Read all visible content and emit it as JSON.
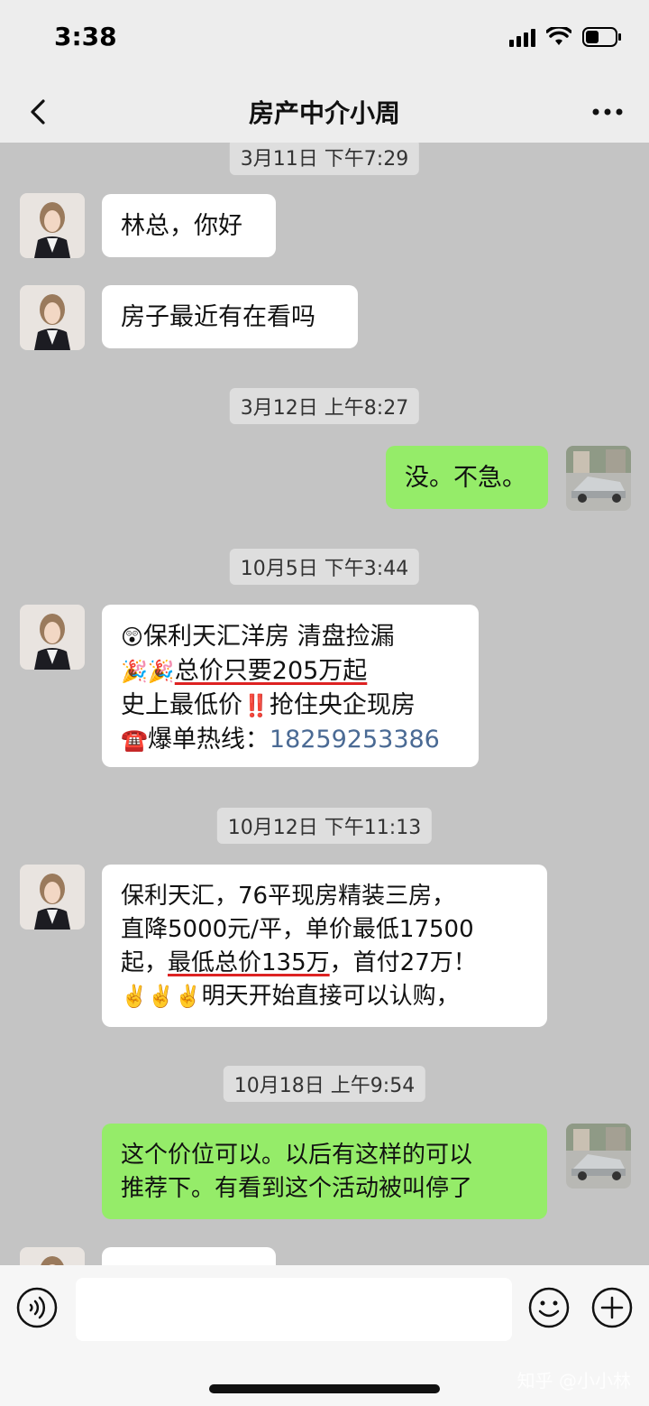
{
  "status": {
    "time": "3:38"
  },
  "header": {
    "title": "房产中介小周"
  },
  "messages": {
    "ts1": "3月11日 下午7:29",
    "m1": "林总，你好",
    "m2": "房子最近有在看吗",
    "ts2": "3月12日 上午8:27",
    "m3": "没。不急。",
    "ts3": "10月5日 下午3:44",
    "m4": {
      "l1_emoji": "😲",
      "l1": "保利天汇洋房 清盘捡漏",
      "l2_emoji": "🎉🎉",
      "l2": "总价只要205万起",
      "l3a": "史上最低价",
      "l3_emoji": "‼️",
      "l3b": "抢住央企现房",
      "l4_emoji": "☎️",
      "l4a": "爆单热线：",
      "l4b": "18259253386"
    },
    "ts4": "10月12日 下午11:13",
    "m5": {
      "l1": "保利天汇，76平现房精装三房，",
      "l2": "直降5000元/平，单价最低17500",
      "l3a": "起，",
      "l3b": "最低总价135万",
      "l3c": "，首付27万！",
      "l4_emoji": "✌️✌️✌️",
      "l4": "明天开始直接可以认购，"
    },
    "ts5": "10月18日 上午9:54",
    "m6": {
      "l1": "这个价位可以。以后有这样的可以",
      "l2": "推荐下。有看到这个活动被叫停了"
    }
  },
  "watermark": "知乎 @小小林",
  "colors": {
    "sent_bubble": "#95ec69",
    "received_bubble": "#ffffff",
    "background": "#c4c4c4",
    "underline": "#dd2222"
  }
}
